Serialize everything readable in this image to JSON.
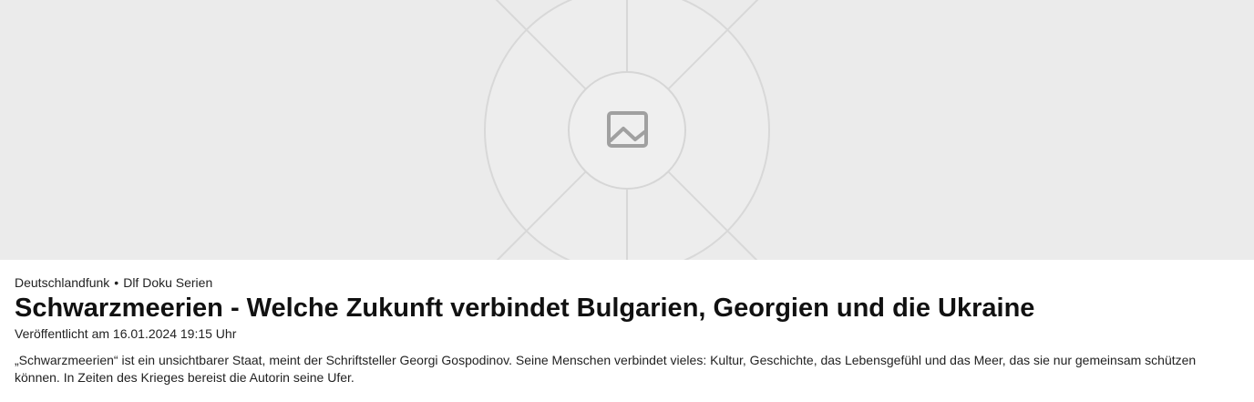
{
  "hero": {
    "placeholder_icon": "image-placeholder-icon",
    "background_color": "#ebebeb",
    "line_color": "#d6d6d6",
    "icon_color": "#a0a0a0"
  },
  "article": {
    "broadcaster": "Deutschlandfunk",
    "separator": "•",
    "series": "Dlf Doku Serien",
    "title": "Schwarzmeerien - Welche Zukunft verbindet Bulgarien, Georgien und die Ukraine",
    "published": "Veröffentlicht am 16.01.2024 19:15 Uhr",
    "teaser": "„Schwarzmeerien“ ist ein unsichtbarer Staat, meint der Schriftsteller Georgi Gospodinov. Seine Menschen verbindet vieles: Kultur, Geschichte, das Lebensgefühl und das Meer, das sie nur gemeinsam schützen können. In Zeiten des Krieges bereist die Autorin seine Ufer."
  }
}
